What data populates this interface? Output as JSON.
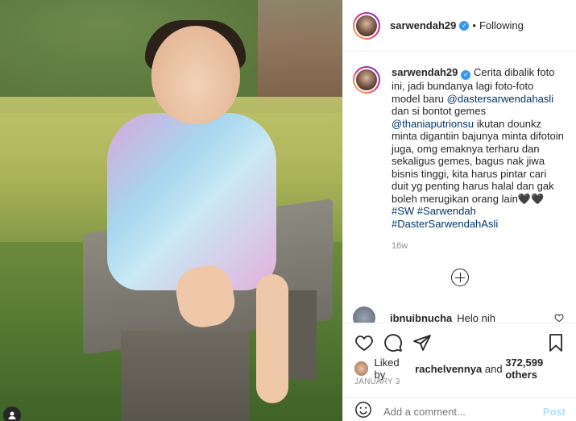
{
  "photo": {
    "description_icon": "user-tag-icon"
  },
  "header": {
    "username": "sarwendah29",
    "separator": "•",
    "follow_status": "Following"
  },
  "caption": {
    "username": "sarwendah29",
    "text_1": "Cerita dibalik foto ini, jadi bundanya lagi foto-foto model baru ",
    "mention_1": "@dastersarwendahasli",
    "text_2": " dan si bontot gemes ",
    "mention_2": "@thaniaputrionsu",
    "text_3": " ikutan dounkz minta digantiin bajunya minta difotoin juga, omg emaknya terharu dan sekaligus gemes, bagus nak jiwa bisnis tinggi, kita harus pintar cari duit yg penting harus halal dan gak boleh merugikan orang lain🖤🖤 ",
    "hashtag_1": "#SW",
    "hashtag_2": "#Sarwendah",
    "hashtag_3": "#DasterSarwendahAsli",
    "time": "16w"
  },
  "comments": [
    {
      "username": "ibnuibnucha",
      "text": "Helo nih"
    }
  ],
  "likes": {
    "prefix": "Liked by ",
    "user": "rachelvennya",
    "middle": " and ",
    "count": "372,599 others"
  },
  "date": "JANUARY 3",
  "add_comment": {
    "placeholder": "Add a comment...",
    "post_label": "Post"
  },
  "colors": {
    "verified": "#3897f0",
    "link": "#00376b",
    "post_disabled": "#b2dffc"
  }
}
